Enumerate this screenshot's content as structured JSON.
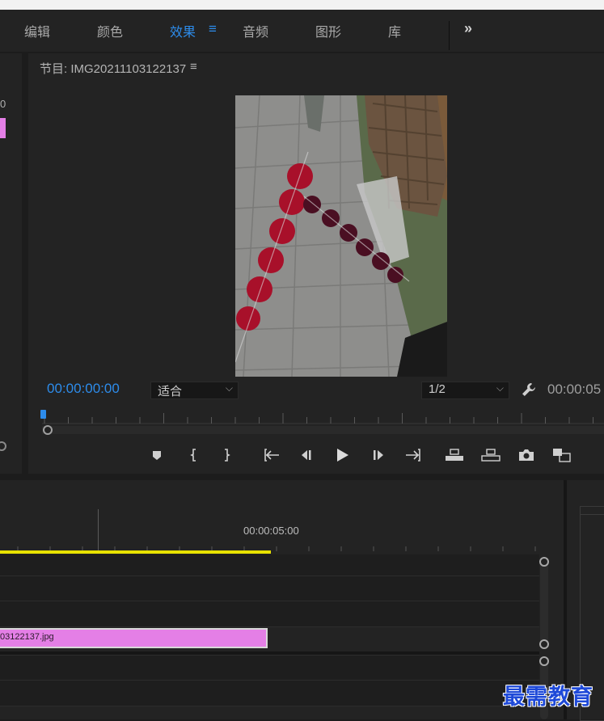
{
  "workspace_tabs": [
    {
      "label": "编辑",
      "active": false
    },
    {
      "label": "颜色",
      "active": false
    },
    {
      "label": "效果",
      "active": true
    },
    {
      "label": "音频",
      "active": false
    },
    {
      "label": "图形",
      "active": false
    },
    {
      "label": "库",
      "active": false
    }
  ],
  "workspace_menu_icon": "hamburger-menu-icon",
  "workspace_overflow": "»",
  "left_panel": {
    "partial_value": "0"
  },
  "monitor": {
    "title": "节目: IMG20211103122137",
    "menu_glyph": "≡",
    "timecode": "00:00:00:00",
    "fit_select": "适合",
    "resolution_select": "1/2",
    "duration": "00:00:05",
    "playhead_fraction": 0.0,
    "transport_icons": [
      "add-marker-icon",
      "mark-in-icon",
      "mark-out-icon",
      "go-to-in-icon",
      "step-back-icon",
      "play-icon",
      "step-forward-icon",
      "go-to-out-icon",
      "lift-icon",
      "extract-icon",
      "export-frame-icon",
      "comparison-view-icon"
    ]
  },
  "timeline": {
    "ruler_time": "00:00:05:00",
    "clip_label": "03122137.jpg"
  },
  "watermark": "最需教育",
  "colors": {
    "accent": "#2d8ceb",
    "clip": "#e47fe6",
    "work_area": "#e8e200",
    "panel": "#232323"
  }
}
